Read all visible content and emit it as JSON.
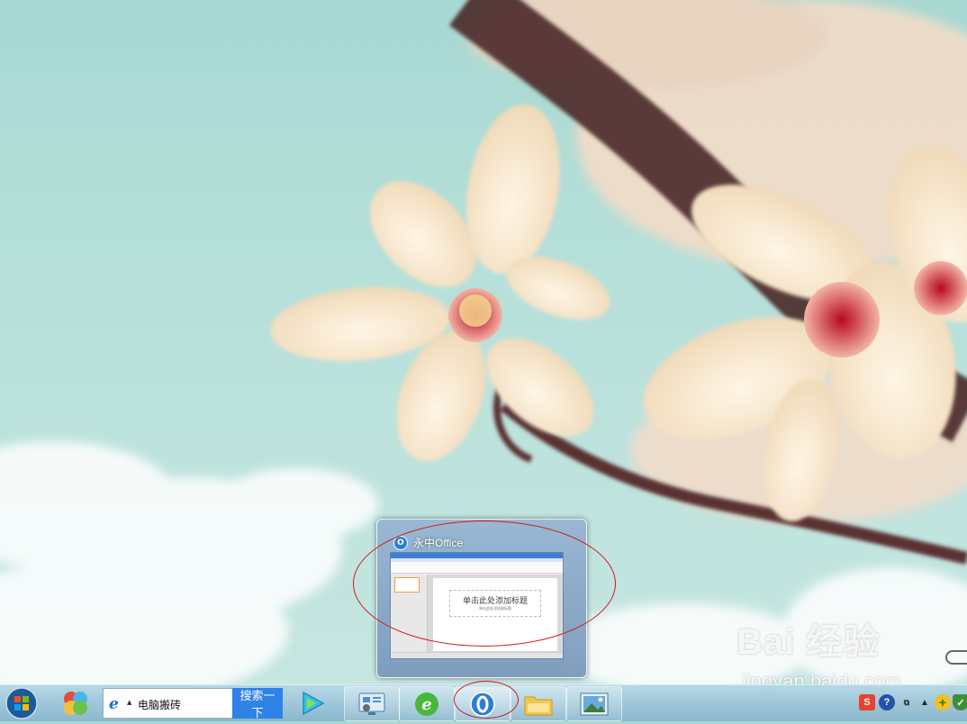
{
  "preview": {
    "app_title": "永中Office",
    "slide_title_placeholder": "单击此处添加标题",
    "slide_subtitle_placeholder": "单击此处添加副标题"
  },
  "search": {
    "query": "电脑搬砖",
    "button_label": "搜索一下"
  },
  "watermark": {
    "logo": "Bai 经验",
    "url": "jingyan.baidu.com"
  },
  "taskbar": {
    "items": [
      {
        "icon": "windows-start-icon"
      },
      {
        "icon": "360-icon"
      },
      {
        "icon": "ie-icon"
      },
      {
        "icon": "media-player-icon"
      },
      {
        "icon": "control-panel-icon"
      },
      {
        "icon": "360-browser-icon"
      },
      {
        "icon": "yozo-office-icon"
      },
      {
        "icon": "file-explorer-icon"
      },
      {
        "icon": "photo-viewer-icon"
      }
    ],
    "tray": [
      "sogou-input-icon",
      "help-icon",
      "show-desktop-icon",
      "up-arrow-icon",
      "add-icon",
      "security-shield-icon"
    ]
  },
  "colors": {
    "accent": "#2f82e8",
    "highlight": "#d01818",
    "yozo_blue": "#2a7fd5"
  }
}
